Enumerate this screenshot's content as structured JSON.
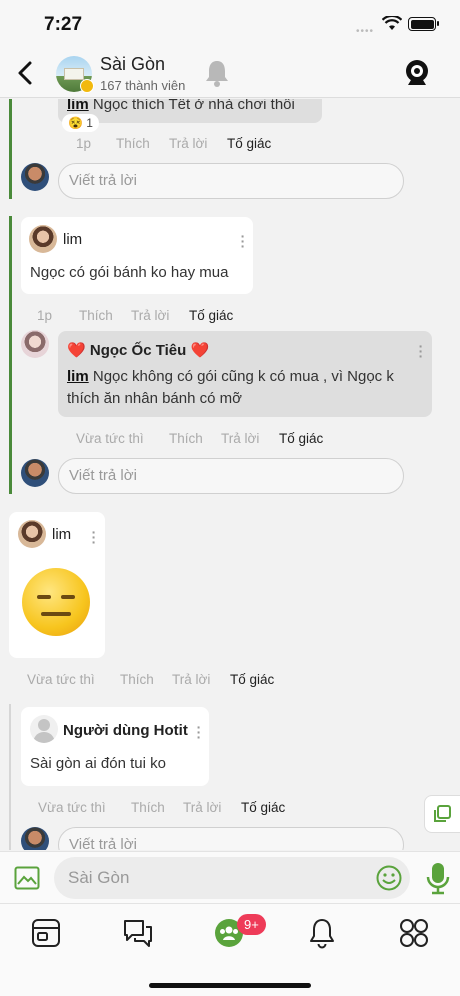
{
  "status_bar": {
    "time": "7:27",
    "signal": "••••"
  },
  "header": {
    "title": "Sài Gòn",
    "subtitle": "167 thành viên"
  },
  "thread_a": {
    "partial_comment_text": "Ngọc thích Tết ở nhà chơi thôi",
    "partial_comment_mention": "lim",
    "reaction_count": "1",
    "reaction_emoji": "😵",
    "actions": {
      "time": "1p",
      "like": "Thích",
      "reply": "Trả lời",
      "report": "Tố giác"
    },
    "reply_placeholder": "Viết trả lời"
  },
  "thread_b": {
    "comment": {
      "author": "lim",
      "text": "Ngọc có gói bánh ko hay mua",
      "actions": {
        "time": "1p",
        "like": "Thích",
        "reply": "Trả lời",
        "report": "Tố giác"
      }
    },
    "reply": {
      "author": "Ngọc Ốc Tiêu",
      "heart_emoji": "❤️",
      "mention": "lim",
      "text_line1": "Ngọc không có gói cũng k có mua , vì Ngọc k",
      "text_line2": "thích ăn nhân bánh có mỡ",
      "actions": {
        "time": "Vừa tức thì",
        "like": "Thích",
        "reply": "Trả lời",
        "report": "Tố giác"
      }
    },
    "reply_placeholder": "Viết trả lời"
  },
  "post": {
    "author": "lim",
    "sticker": "expressionless-face",
    "actions": {
      "time": "Vừa tức thì",
      "like": "Thích",
      "reply": "Trả lời",
      "report": "Tố giác"
    }
  },
  "thread_c": {
    "comment": {
      "author": "Người dùng Hotit",
      "text": "Sài gòn ai đón tui ko",
      "actions": {
        "time": "Vừa tức thì",
        "like": "Thích",
        "reply": "Trả lời",
        "report": "Tố giác"
      }
    },
    "reply_placeholder": "Viết trả lời"
  },
  "composer": {
    "placeholder": "Sài Gòn"
  },
  "tabbar": {
    "community_badge": "9+"
  },
  "colors": {
    "accent_green": "#4a8a3a",
    "badge_red": "#ee3b58",
    "mic_green": "#5aa33c"
  }
}
